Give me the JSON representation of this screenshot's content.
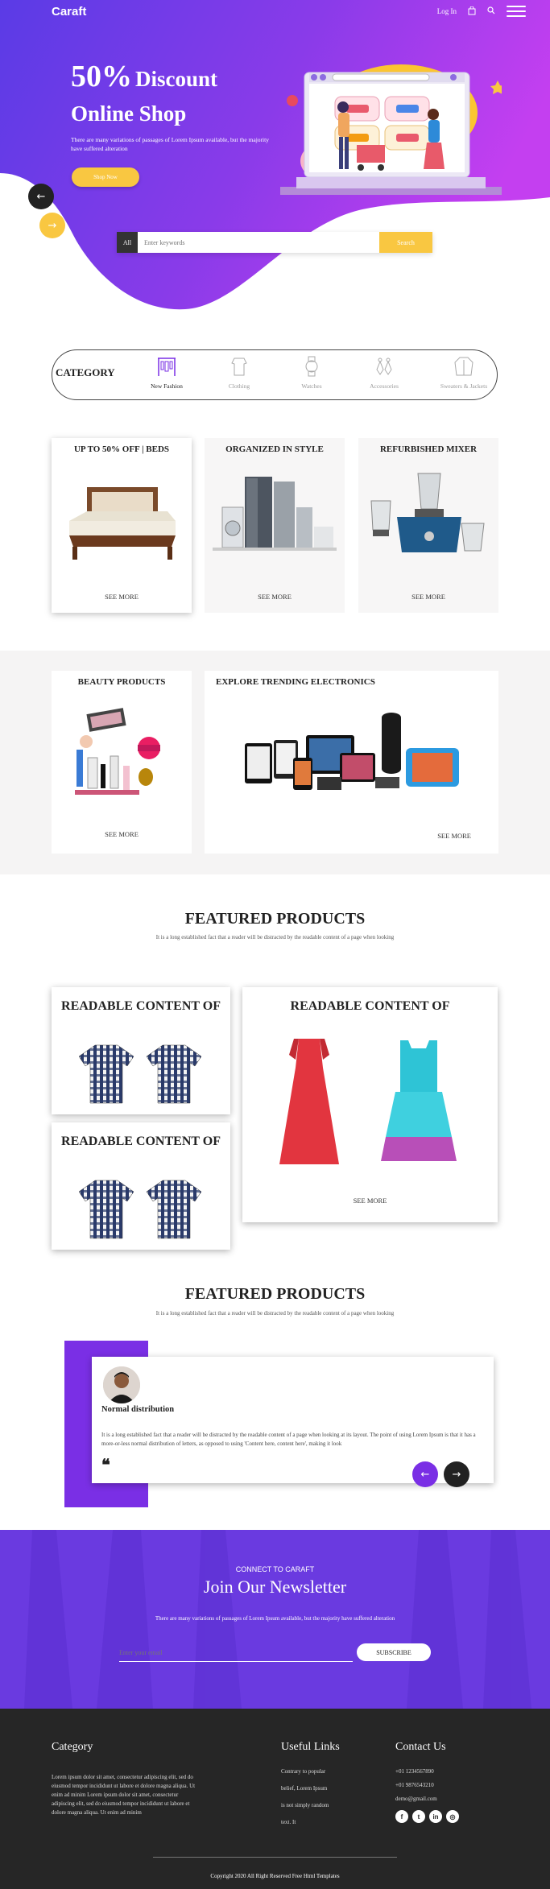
{
  "header": {
    "logo": "Caraft",
    "login": "Log In"
  },
  "hero": {
    "title_part1": "50%",
    "title_part2": "Discount",
    "title_line2": "Online Shop",
    "description": "There are many variations of passages of Lorem Ipsum available, but the majority have suffered alteration",
    "shop_button": "Shop Now",
    "prev_arrow": "←",
    "next_arrow": "→"
  },
  "search": {
    "category": "All",
    "placeholder": "Enter keywords",
    "button": "Search"
  },
  "categories": {
    "label": "CATEGORY",
    "items": [
      {
        "label": "New Fashion",
        "icon": "clothes-rack-icon",
        "active": true
      },
      {
        "label": "Clothing",
        "icon": "clothing-icon",
        "active": false
      },
      {
        "label": "Watches",
        "icon": "watch-icon",
        "active": false
      },
      {
        "label": "Accessories",
        "icon": "earrings-icon",
        "active": false
      },
      {
        "label": "Sweaters & Jackets",
        "icon": "jacket-icon",
        "active": false
      }
    ]
  },
  "promos": [
    {
      "title": "UP TO 50% OFF | BEDS",
      "more": "SEE MORE"
    },
    {
      "title": "ORGANIZED IN STYLE",
      "more": "SEE MORE"
    },
    {
      "title": "REFURBISHED MIXER",
      "more": "SEE MORE"
    },
    {
      "title": "BEAUTY PRODUCTS",
      "more": "SEE MORE"
    },
    {
      "title": "EXPLORE TRENDING ELECTRONICS",
      "more": "SEE MORE"
    }
  ],
  "featured1": {
    "title": "FEATURED PRODUCTS",
    "subtitle": "It is a long established fact that a reader will be distracted by the readable content of a page when looking",
    "card_small_1": "READABLE CONTENT OF",
    "card_small_2": "READABLE CONTENT OF",
    "card_large": "READABLE CONTENT OF",
    "card_large_more": "SEE MORE"
  },
  "featured2": {
    "title": "FEATURED PRODUCTS",
    "subtitle": "It is a long established fact that a reader will be distracted by the readable content of a page when looking"
  },
  "testimonial": {
    "name": "Normal distribution",
    "text": "It is a long established fact that a reader will be distracted by the readable content of a page when looking at its layout. The point of using Lorem Ipsum is that it has a more-or-less normal distribution of letters, as opposed to using 'Content here, content here', making it look",
    "quote": "❝",
    "prev": "←",
    "next": "→"
  },
  "newsletter": {
    "kicker": "CONNECT TO CARAFT",
    "title": "Join Our Newsletter",
    "description": "There are many variations of passages of Lorem Ipsum available, but the majority have suffered alteration",
    "placeholder": "Enter your email",
    "button": "SUBSCRIBE"
  },
  "footer": {
    "category_title": "Category",
    "category_text": "Lorem ipsum dolor sit amet, consectetur adipiscing elit, sed do eiusmod tempor incididunt ut labore et dolore magna aliqua. Ut enim ad minim Lorem ipsum dolor sit amet, consectetur adipiscing elit, sed do eiusmod tempor incididunt ut labore et dolore magna aliqua. Ut enim ad minim",
    "links_title": "Useful Links",
    "links": [
      "Contrary to popular",
      "belief, Lorem Ipsum",
      "is not simply random",
      "text. It"
    ],
    "contact_title": "Contact Us",
    "phone1": "+01 1234567890",
    "phone2": "+01 9876543210",
    "email": "demo@gmail.com",
    "social": [
      {
        "icon": "facebook-icon",
        "glyph": "f"
      },
      {
        "icon": "twitter-icon",
        "glyph": "t"
      },
      {
        "icon": "linkedin-icon",
        "glyph": "in"
      },
      {
        "icon": "instagram-icon",
        "glyph": "◎"
      }
    ],
    "copyright": "Copyright 2020 All Right Reserved Free Html Templates"
  },
  "colors": {
    "brand_purple": "#7a2fe5",
    "accent_yellow": "#f9c741",
    "footer_bg": "#262626"
  }
}
